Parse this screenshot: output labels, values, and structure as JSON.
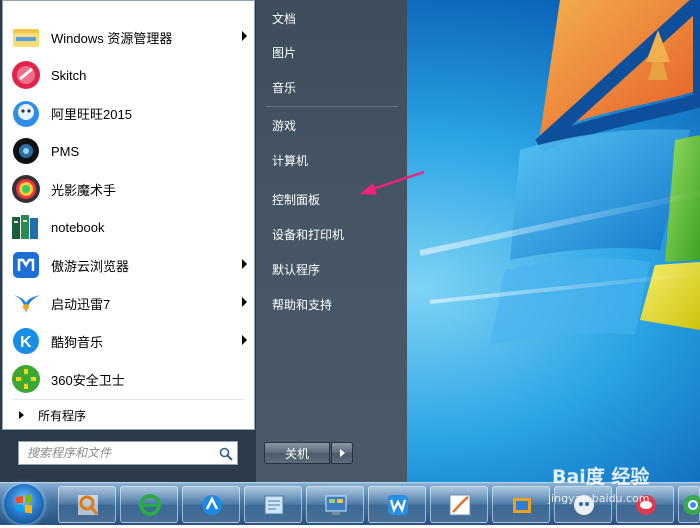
{
  "programs": [
    {
      "label": "Windows 资源管理器",
      "has_submenu": true,
      "icon": "file-explorer-icon"
    },
    {
      "label": "Skitch",
      "has_submenu": false,
      "icon": "skitch-icon"
    },
    {
      "label": "阿里旺旺2015",
      "has_submenu": false,
      "icon": "aliwangwang-icon"
    },
    {
      "label": "PMS",
      "has_submenu": false,
      "icon": "pms-icon"
    },
    {
      "label": "光影魔术手",
      "has_submenu": false,
      "icon": "nevercolor-icon"
    },
    {
      "label": "notebook",
      "has_submenu": false,
      "icon": "notebook-icon"
    },
    {
      "label": "傲游云浏览器",
      "has_submenu": true,
      "icon": "maxthon-icon"
    },
    {
      "label": "启动迅雷7",
      "has_submenu": true,
      "icon": "xunlei-icon"
    },
    {
      "label": "酷狗音乐",
      "has_submenu": true,
      "icon": "kugou-icon"
    },
    {
      "label": "360安全卫士",
      "has_submenu": false,
      "icon": "360-safe-icon"
    }
  ],
  "all_programs": "所有程序",
  "search": {
    "placeholder": "搜索程序和文件"
  },
  "right_links": [
    "文档",
    "图片",
    "音乐",
    "游戏",
    "计算机",
    "控制面板",
    "设备和打印机",
    "默认程序",
    "帮助和支持"
  ],
  "shutdown_label": "关机",
  "taskbar_items": [
    "search-magnifier-icon",
    "ie-browser-icon",
    "maxthon-icon",
    "notepad-icon",
    "control-panel-icon",
    "wps-icon",
    "drawing-app-icon",
    "box-app-icon",
    "ghost-icon",
    "chat-icon",
    "chrome-icon"
  ],
  "watermark": {
    "line1": "Bai度 经验",
    "line2": "jingyan.baidu.com"
  },
  "colors": {
    "arrow": "#ee2277",
    "right_pane": "#45505e",
    "start_orb": "#2a7bcc"
  }
}
